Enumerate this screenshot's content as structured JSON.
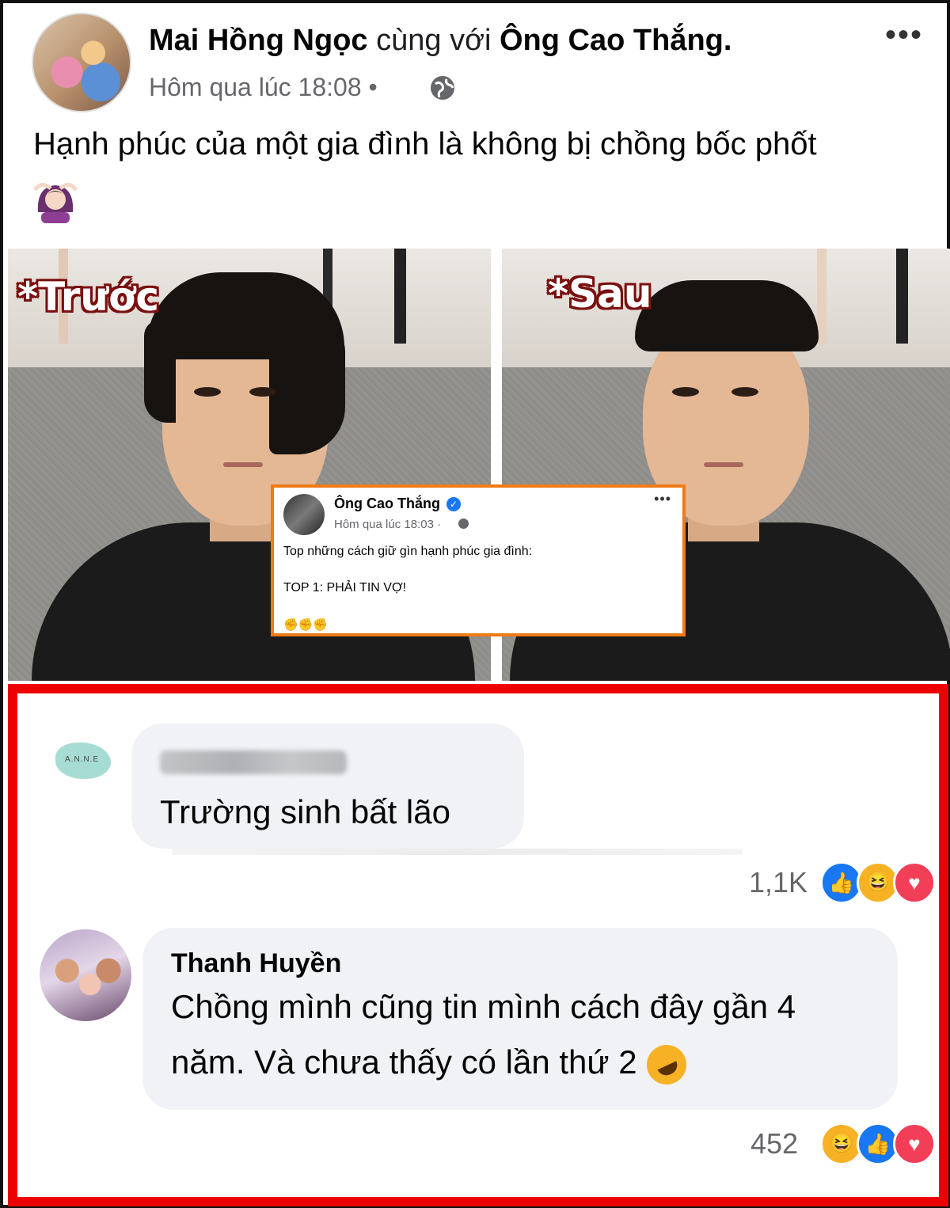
{
  "post": {
    "author": "Mai Hồng Ngọc",
    "with_text": "cùng với",
    "tagged": "Ông Cao Thắng.",
    "time": "Hôm qua lúc 18:08",
    "separator": "•",
    "privacy_icon": "globe-icon",
    "more_icon": "more-icon",
    "text": "Hạnh phúc của một gia đình là không bị chồng bốc phốt",
    "emoji": "woman-gesturing-ok-icon"
  },
  "photos": {
    "before_label": "*Trước",
    "after_label": "*Sau"
  },
  "inset_post": {
    "author": "Ông Cao Thắng",
    "verified_icon": "verified-badge-icon",
    "time": "Hôm qua lúc 18:03 ·",
    "line1": "Top những cách giữ gìn hạnh phúc gia đình:",
    "line2": "TOP 1: PHẢI TIN VỢ!",
    "fists": "✊✊✊"
  },
  "comments": [
    {
      "author_blurred": true,
      "avatar_text": "A.N.N.E",
      "text": "Trường sinh bất lão",
      "reaction_count": "1,1K",
      "reactions": [
        "like",
        "haha",
        "love"
      ]
    },
    {
      "author": "Thanh Huyền",
      "line1": "Chồng mình cũng tin mình cách đây gần 4",
      "line2": "năm. Và chưa thấy có lần thứ 2",
      "emoji": "rolling-on-floor-laughing-icon",
      "reaction_count": "452",
      "reactions": [
        "haha",
        "like",
        "love"
      ]
    }
  ],
  "colors": {
    "comments_border": "#ef0000",
    "inset_border": "#f07a16",
    "like": "#1877f2",
    "haha": "#f7b125",
    "love": "#f33e58",
    "label_outline": "#7a0f0f"
  }
}
